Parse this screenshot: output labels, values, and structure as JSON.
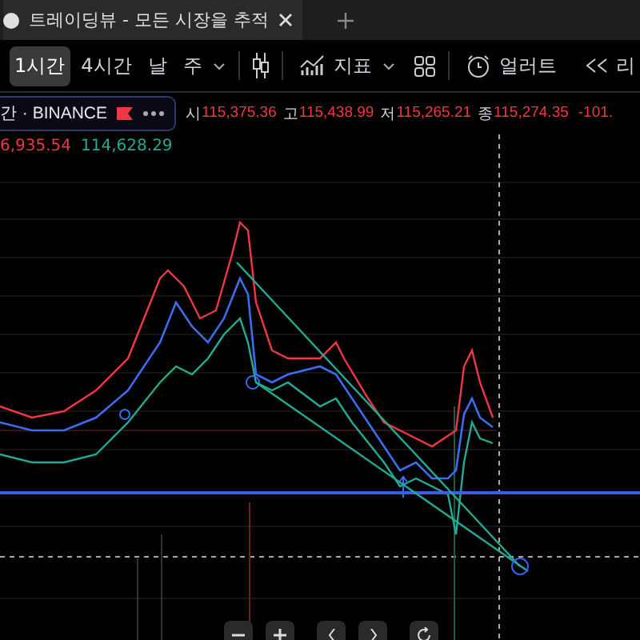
{
  "tab": {
    "title": "트레이딩뷰 - 모든 시장을 추적",
    "selected": true
  },
  "toolbar": {
    "intervals": [
      {
        "label": "1시간",
        "selected": true
      },
      {
        "label": "4시간",
        "selected": false
      },
      {
        "label": "날",
        "selected": false
      },
      {
        "label": "주",
        "selected": false
      }
    ],
    "indicators_label": "지표",
    "alert_label": "얼러트",
    "replay_label": "리"
  },
  "legend": {
    "symbol": "간 · BINANCE",
    "ohlc": [
      {
        "key": "시",
        "value": "115,375.36"
      },
      {
        "key": "고",
        "value": "115,438.99"
      },
      {
        "key": "저",
        "value": "115,265.21"
      },
      {
        "key": "종",
        "value": "115,274.35"
      }
    ],
    "change": "-101.",
    "indicator_values": [
      {
        "value": "6,935.54",
        "color": "#f23645"
      },
      {
        "value": "114,628.29",
        "color": "#22ab94"
      }
    ]
  }
}
